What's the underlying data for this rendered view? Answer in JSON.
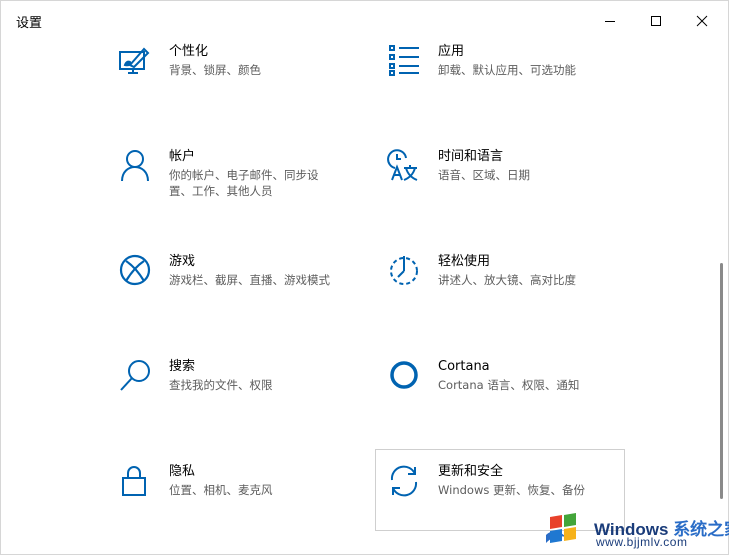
{
  "window": {
    "title": "设置",
    "controls": {
      "minimize": "minimize",
      "maximize": "maximize",
      "close": "close"
    }
  },
  "tiles": [
    {
      "name": "个性化",
      "desc": [
        "背景、锁屏、颜色"
      ],
      "icon": "personalization-icon"
    },
    {
      "name": "应用",
      "desc": [
        "卸载、默认应用、可选功能"
      ],
      "icon": "apps-icon"
    },
    {
      "name": "帐户",
      "desc": [
        "你的帐户、电子邮件、同步设",
        "置、工作、其他人员"
      ],
      "icon": "accounts-icon"
    },
    {
      "name": "时间和语言",
      "desc": [
        "语音、区域、日期"
      ],
      "icon": "time-language-icon"
    },
    {
      "name": "游戏",
      "desc": [
        "游戏栏、截屏、直播、游戏模式"
      ],
      "icon": "xbox-icon"
    },
    {
      "name": "轻松使用",
      "desc": [
        "讲述人、放大镜、高对比度"
      ],
      "icon": "ease-of-access-icon"
    },
    {
      "name": "搜索",
      "desc": [
        "查找我的文件、权限"
      ],
      "icon": "search-icon"
    },
    {
      "name": "Cortana",
      "desc": [
        "Cortana 语言、权限、通知"
      ],
      "icon": "cortana-icon"
    },
    {
      "name": "隐私",
      "desc": [
        "位置、相机、麦克风"
      ],
      "icon": "lock-icon"
    },
    {
      "name": "更新和安全",
      "desc": [
        "Windows 更新、恢复、备份"
      ],
      "icon": "update-icon"
    }
  ],
  "watermark": {
    "brand": "Windows",
    "brand_suffix": "系统之家",
    "url": "www.bjjmlv.com"
  },
  "colors": {
    "accent": "#0063b1",
    "text": "#000000",
    "secondary_text": "#5d5d5d"
  }
}
